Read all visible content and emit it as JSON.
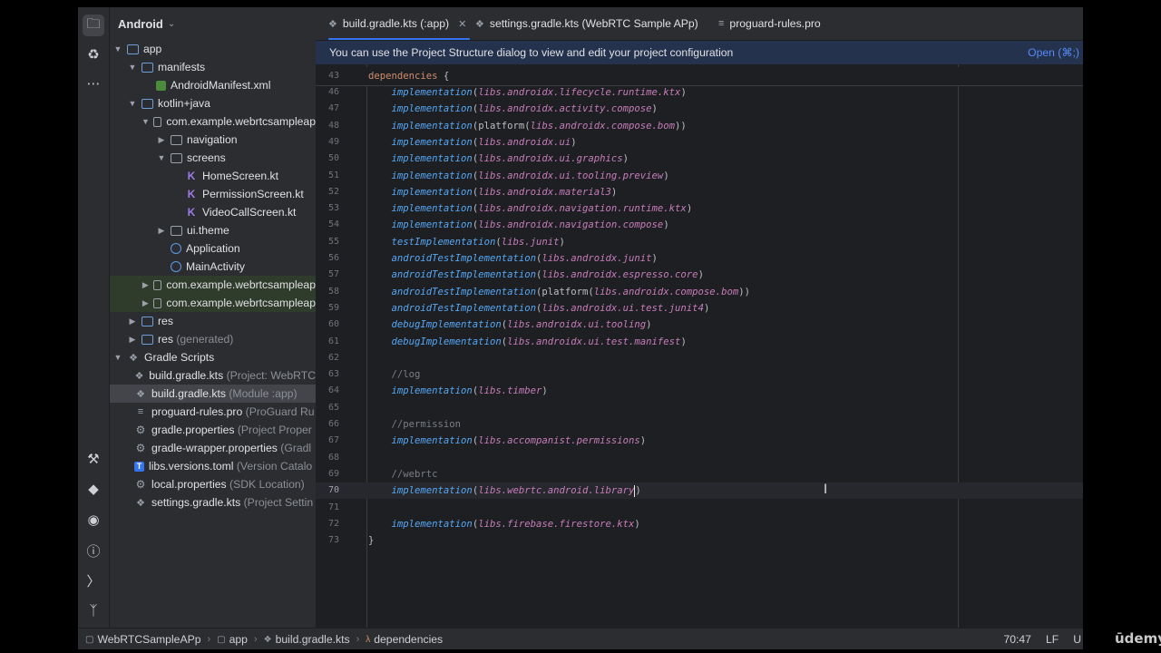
{
  "project_panel": {
    "title": "Android",
    "tree": [
      {
        "label": "app",
        "hint": ""
      },
      {
        "label": "manifests",
        "hint": ""
      },
      {
        "label": "AndroidManifest.xml",
        "hint": ""
      },
      {
        "label": "kotlin+java",
        "hint": ""
      },
      {
        "label": "com.example.webrtcsampleap",
        "hint": ""
      },
      {
        "label": "navigation",
        "hint": ""
      },
      {
        "label": "screens",
        "hint": ""
      },
      {
        "label": "HomeScreen.kt",
        "hint": ""
      },
      {
        "label": "PermissionScreen.kt",
        "hint": ""
      },
      {
        "label": "VideoCallScreen.kt",
        "hint": ""
      },
      {
        "label": "ui.theme",
        "hint": ""
      },
      {
        "label": "Application",
        "hint": ""
      },
      {
        "label": "MainActivity",
        "hint": ""
      },
      {
        "label": "com.example.webrtcsampleap",
        "hint": ""
      },
      {
        "label": "com.example.webrtcsampleap",
        "hint": ""
      },
      {
        "label": "res",
        "hint": ""
      },
      {
        "label": "res",
        "hint": "(generated)"
      },
      {
        "label": "Gradle Scripts",
        "hint": ""
      },
      {
        "label": "build.gradle.kts",
        "hint": "(Project: WebRTC"
      },
      {
        "label": "build.gradle.kts",
        "hint": "(Module :app)"
      },
      {
        "label": "proguard-rules.pro",
        "hint": "(ProGuard Ru"
      },
      {
        "label": "gradle.properties",
        "hint": "(Project Proper"
      },
      {
        "label": "gradle-wrapper.properties",
        "hint": "(Gradl"
      },
      {
        "label": "libs.versions.toml",
        "hint": "(Version Catalo"
      },
      {
        "label": "local.properties",
        "hint": "(SDK Location)"
      },
      {
        "label": "settings.gradle.kts",
        "hint": "(Project Settin"
      }
    ]
  },
  "tabs": [
    {
      "label": "build.gradle.kts (:app)"
    },
    {
      "label": "settings.gradle.kts (WebRTC Sample APp)"
    },
    {
      "label": "proguard-rules.pro"
    }
  ],
  "banner": {
    "text": "You can use the Project Structure dialog to view and edit your project configuration",
    "link": "Open (⌘;)"
  },
  "editor": {
    "sticky": {
      "number": "43",
      "keyword": "dependencies",
      "brace": " {"
    },
    "lines": [
      {
        "number": "46",
        "fn": "implementation",
        "ref": "libs.androidx.lifecycle.runtime.ktx",
        "tail": ")"
      },
      {
        "number": "47",
        "fn": "implementation",
        "ref": "libs.androidx.activity.compose",
        "tail": ")"
      },
      {
        "number": "48",
        "fn": "implementation",
        "mid": "(platform(",
        "ref": "libs.androidx.compose.bom",
        "tail": "))"
      },
      {
        "number": "49",
        "fn": "implementation",
        "ref": "libs.androidx.ui",
        "tail": ")"
      },
      {
        "number": "50",
        "fn": "implementation",
        "ref": "libs.androidx.ui.graphics",
        "tail": ")"
      },
      {
        "number": "51",
        "fn": "implementation",
        "ref": "libs.androidx.ui.tooling.preview",
        "tail": ")"
      },
      {
        "number": "52",
        "fn": "implementation",
        "ref": "libs.androidx.material3",
        "tail": ")"
      },
      {
        "number": "53",
        "fn": "implementation",
        "ref": "libs.androidx.navigation.runtime.ktx",
        "tail": ")"
      },
      {
        "number": "54",
        "fn": "implementation",
        "ref": "libs.androidx.navigation.compose",
        "tail": ")"
      },
      {
        "number": "55",
        "fn": "testImplementation",
        "ref": "libs.junit",
        "tail": ")"
      },
      {
        "number": "56",
        "fn": "androidTestImplementation",
        "ref": "libs.androidx.junit",
        "tail": ")"
      },
      {
        "number": "57",
        "fn": "androidTestImplementation",
        "ref": "libs.androidx.espresso.core",
        "tail": ")"
      },
      {
        "number": "58",
        "fn": "androidTestImplementation",
        "mid": "(platform(",
        "ref": "libs.androidx.compose.bom",
        "tail": "))"
      },
      {
        "number": "59",
        "fn": "androidTestImplementation",
        "ref": "libs.androidx.ui.test.junit4",
        "tail": ")"
      },
      {
        "number": "60",
        "fn": "debugImplementation",
        "ref": "libs.androidx.ui.tooling",
        "tail": ")"
      },
      {
        "number": "61",
        "fn": "debugImplementation",
        "ref": "libs.androidx.ui.test.manifest",
        "tail": ")"
      },
      {
        "number": "62"
      },
      {
        "number": "63",
        "comment": "//log"
      },
      {
        "number": "64",
        "fn": "implementation",
        "ref": "libs.timber",
        "tail": ")"
      },
      {
        "number": "65"
      },
      {
        "number": "66",
        "comment": "//permission"
      },
      {
        "number": "67",
        "fn": "implementation",
        "ref": "libs.accompanist.permissions",
        "tail": ")"
      },
      {
        "number": "68"
      },
      {
        "number": "69",
        "comment": "//webrtc"
      },
      {
        "number": "70",
        "fn": "implementation",
        "ref": "libs.webrtc.android.library",
        "tail": ")",
        "current": true
      },
      {
        "number": "71"
      },
      {
        "number": "72",
        "fn": "implementation",
        "ref": "libs.firebase.firestore.ktx",
        "tail": ")"
      },
      {
        "number": "73",
        "brace": "}"
      }
    ]
  },
  "status_bar": {
    "breadcrumbs": [
      "WebRTCSampleAPp",
      "app",
      "build.gradle.kts",
      "dependencies"
    ],
    "position": "70:47",
    "line_ending": "LF",
    "encoding": "U"
  },
  "watermark": "ūdemy"
}
